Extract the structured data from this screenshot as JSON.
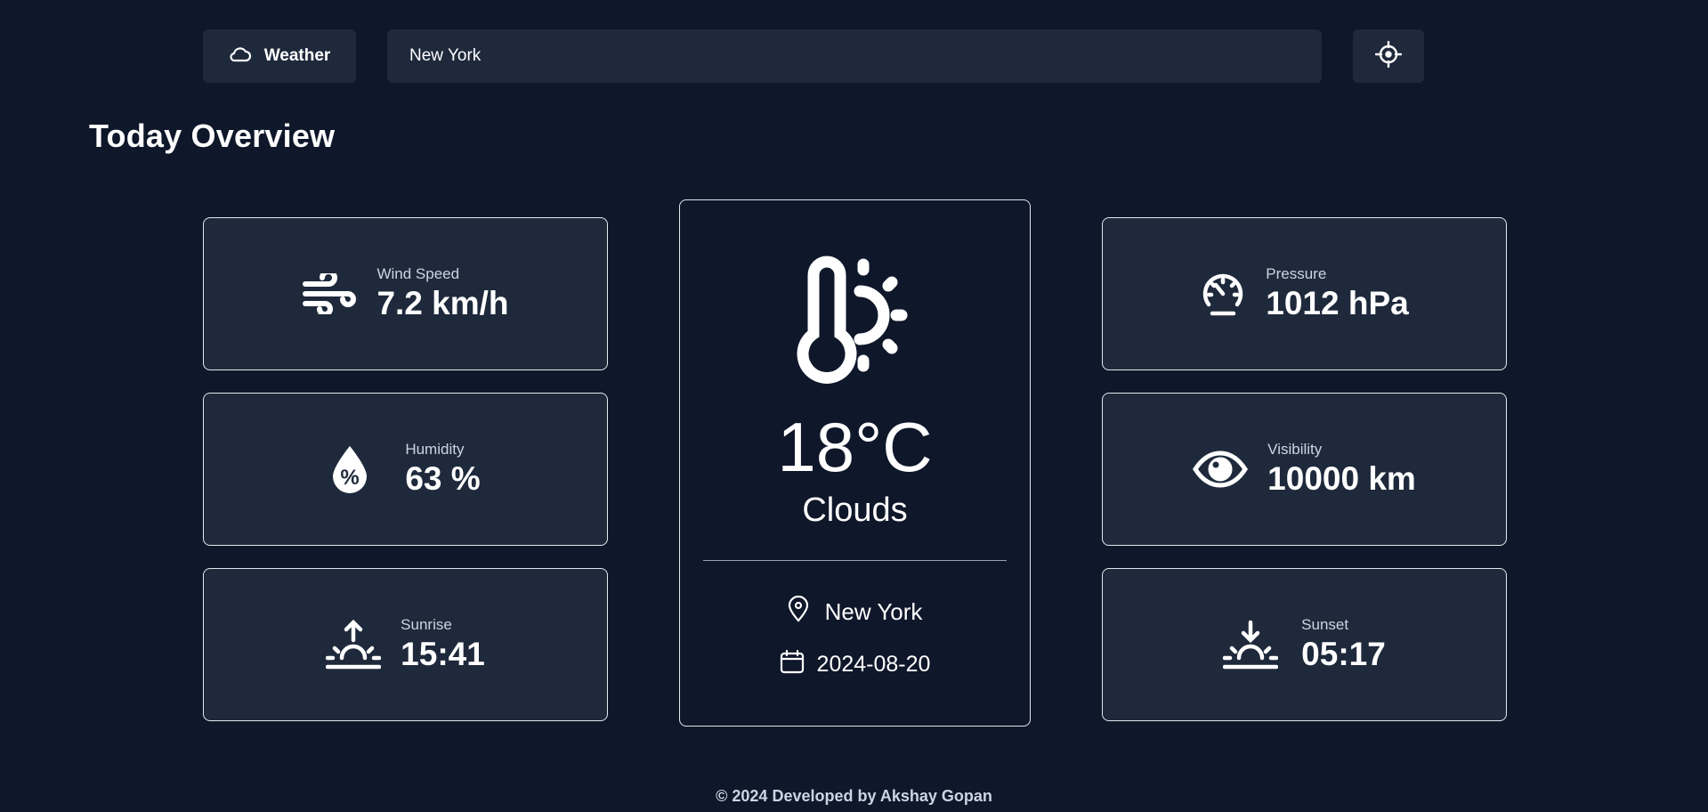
{
  "header": {
    "brand_label": "Weather",
    "search_value": "New York",
    "search_placeholder": ""
  },
  "page_title": "Today Overview",
  "stats": {
    "wind": {
      "label": "Wind Speed",
      "value": "7.2 km/h",
      "icon": "wind-icon"
    },
    "humidity": {
      "label": "Humidity",
      "value": "63 %",
      "icon": "humidity-drop-icon"
    },
    "sunrise": {
      "label": "Sunrise",
      "value": "15:41",
      "icon": "sunrise-icon"
    },
    "pressure": {
      "label": "Pressure",
      "value": "1012 hPa",
      "icon": "gauge-icon"
    },
    "visibility": {
      "label": "Visibility",
      "value": "10000 km",
      "icon": "eye-icon"
    },
    "sunset": {
      "label": "Sunset",
      "value": "05:17",
      "icon": "sunset-icon"
    }
  },
  "current": {
    "temperature": "18°C",
    "condition": "Clouds",
    "location": "New York",
    "date": "2024-08-20",
    "icon": "thermometer-sun-icon"
  },
  "footer": {
    "text": "© 2024 Developed by Akshay Gopan"
  },
  "colors": {
    "background": "#0f172a",
    "card": "#1e293b",
    "border": "#e2e8f0",
    "text": "#ffffff",
    "muted": "#cbd5e1"
  }
}
